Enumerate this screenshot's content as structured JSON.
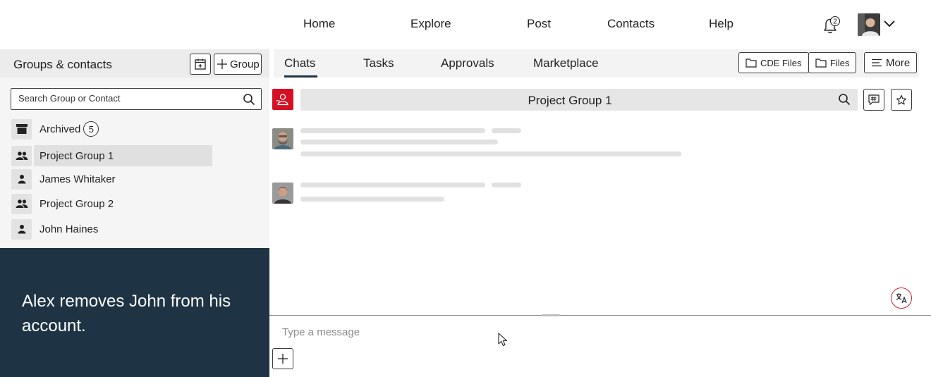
{
  "topnav": {
    "links": [
      "Home",
      "Explore",
      "Post",
      "Contacts",
      "Help"
    ],
    "notification_count": "2"
  },
  "left_panel": {
    "title": "Groups & contacts",
    "group_button_label": "Group",
    "search_placeholder": "Search Group or Contact",
    "archived_label": "Archived",
    "archived_count": "5",
    "contacts": [
      {
        "label": "Project Group 1",
        "type": "group",
        "active": true
      },
      {
        "label": "James Whitaker",
        "type": "person",
        "active": false
      },
      {
        "label": "Project Group 2",
        "type": "group",
        "active": false
      },
      {
        "label": "John Haines",
        "type": "person",
        "active": false
      }
    ]
  },
  "caption": "Alex removes John from his account.",
  "tabs": [
    "Chats",
    "Tasks",
    "Approvals",
    "Marketplace"
  ],
  "toolbar": {
    "cde_files_label": "CDE Files",
    "files_label": "Files",
    "more_label": "More"
  },
  "chat": {
    "title": "Project Group 1",
    "composer_placeholder": "Type a message"
  },
  "colors": {
    "accent_red": "#d50f24",
    "caption_bg": "#1e3444"
  },
  "icons": [
    "bell-icon",
    "chevron-down-icon",
    "calendar-icon",
    "plus-icon",
    "search-icon",
    "archive-icon",
    "group-icon",
    "person-icon",
    "folder-icon",
    "menu-icon",
    "hashtag-chat-icon",
    "star-icon",
    "person-remove-icon",
    "translate-icon",
    "mouse-cursor-icon"
  ]
}
